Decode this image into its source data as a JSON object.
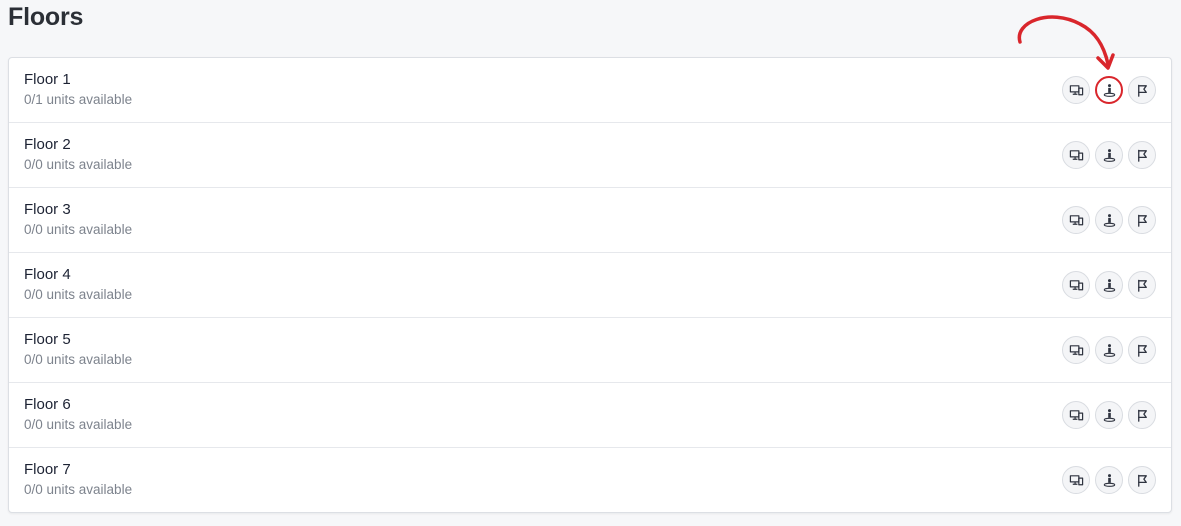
{
  "header": {
    "title": "Floors"
  },
  "floors": [
    {
      "name": "Floor 1",
      "units": "0/1 units available",
      "highlight_action": "person-icon"
    },
    {
      "name": "Floor 2",
      "units": "0/0 units available"
    },
    {
      "name": "Floor 3",
      "units": "0/0 units available"
    },
    {
      "name": "Floor 4",
      "units": "0/0 units available"
    },
    {
      "name": "Floor 5",
      "units": "0/0 units available"
    },
    {
      "name": "Floor 6",
      "units": "0/0 units available"
    },
    {
      "name": "Floor 7",
      "units": "0/0 units available"
    }
  ],
  "row_actions": [
    "devices-icon",
    "person-icon",
    "flag-icon"
  ],
  "colors": {
    "annotation": "#d9262c",
    "background": "#f6f7f9",
    "title": "#2b2f36",
    "icon": "#2f3440"
  }
}
